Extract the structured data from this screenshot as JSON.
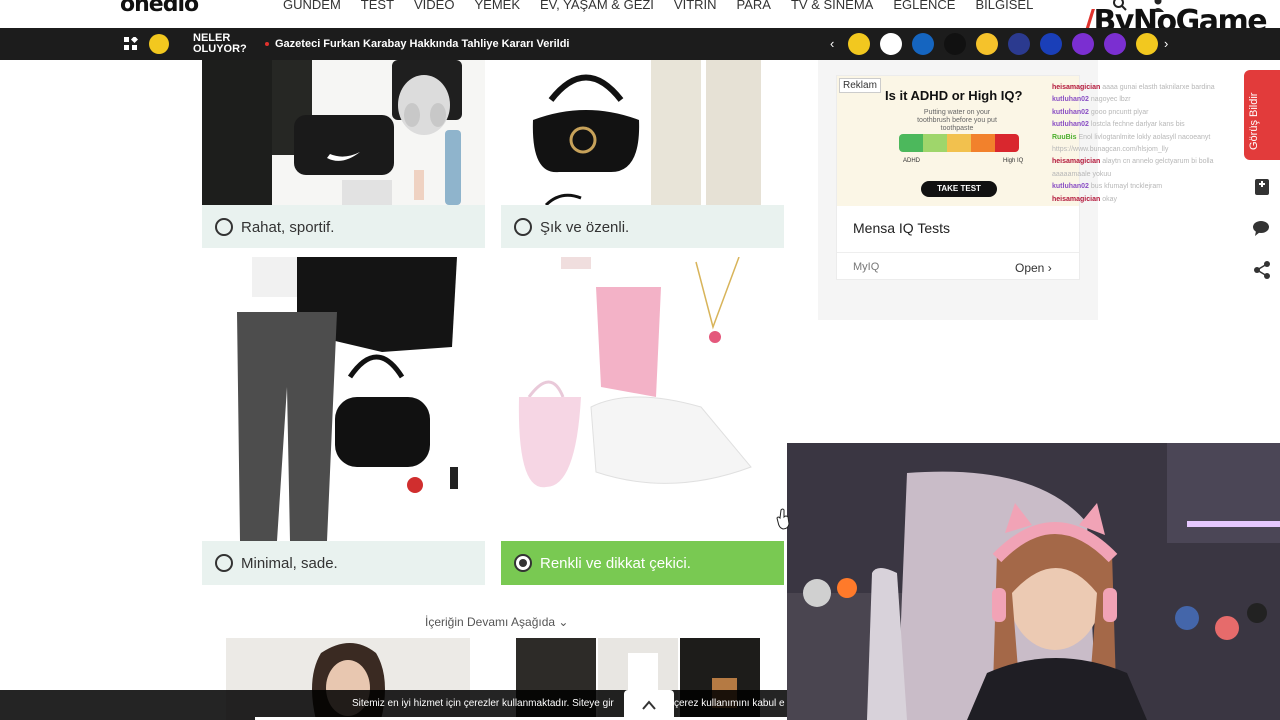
{
  "nav": {
    "logo": "onedio",
    "links": [
      "GÜNDEM",
      "TEST",
      "VİDEO",
      "YEMEK",
      "EV, YAŞAM & GEZİ",
      "VİTRİN",
      "PARA",
      "TV & SİNEMA",
      "EĞLENCE",
      "BİLGİSEL"
    ],
    "icons": [
      "search-icon",
      "user-icon"
    ]
  },
  "overlay_brand": "ByNoGame",
  "ticker": {
    "label_line1": "NELER",
    "label_line2": "OLUYOR?",
    "headline": "Gazeteci Furkan Karabay Hakkında Tahliye Kararı Verildi",
    "prev": "‹",
    "next": "›",
    "badge_colors": [
      "#f2c81f",
      "#ffffff",
      "#1565c0",
      "#111111",
      "#f5c22b",
      "#2b3a8f",
      "#1a3fb8",
      "#7b2fd1",
      "#7b2fd1",
      "#f2c81f"
    ]
  },
  "quiz": {
    "answers": [
      {
        "label": "Rahat, sportif.",
        "selected": false
      },
      {
        "label": "Şık ve özenli.",
        "selected": false
      },
      {
        "label": "Minimal, sade.",
        "selected": false
      },
      {
        "label": "Renkli ve dikkat çekici.",
        "selected": true
      }
    ],
    "more_label": "İçeriğin Devamı Aşağıda"
  },
  "ad": {
    "badge": "Reklam",
    "headline": "Is it ADHD or High IQ?",
    "subline": "Putting water on your toothbrush before you put toothpaste",
    "scale_left": "ADHD",
    "scale_right": "High IQ",
    "cta": "TAKE TEST",
    "title": "Mensa IQ Tests",
    "advertiser": "MyIQ",
    "open_label": "Open"
  },
  "chat": [
    {
      "user": "heisamagician",
      "cls": "u1",
      "msg": "aaaa gunai elasth taknilarxe bardina"
    },
    {
      "user": "kutluhan02",
      "cls": "u2",
      "msg": "nagoyec lbzr"
    },
    {
      "user": "kutluhan02",
      "cls": "u2",
      "msg": "gooo pncuntt plyar"
    },
    {
      "user": "kutluhan02",
      "cls": "u2",
      "msg": "lostcla fechne darlyar kans bis"
    },
    {
      "user": "RuuBis",
      "cls": "u3",
      "msg": "Enol livlogtanlmite lokly aolasyll nacoeanyt"
    },
    {
      "user": "",
      "cls": "u1",
      "msg": "https://www.bunagcan.com/hlsjom_lly"
    },
    {
      "user": "heisamagician",
      "cls": "u1",
      "msg": "alaytn cn annelo gelctyarum bi bolla"
    },
    {
      "user": "",
      "cls": "u1",
      "msg": "aaaaamaale yokuu"
    },
    {
      "user": "kutluhan02",
      "cls": "u2",
      "msg": "bus kfumayl tncklejram"
    },
    {
      "user": "heisamagician",
      "cls": "u1",
      "msg": "okay"
    }
  ],
  "side": {
    "feedback": "Görüş Bildir",
    "icons": [
      "bookmark-icon",
      "comments-icon",
      "share-icon"
    ]
  },
  "cookie": {
    "text_left": "Sitemiz en iyi hizmet için çerezler kullanmaktadır. Siteye gir",
    "text_right": "çerez kullanımını kabul e"
  }
}
